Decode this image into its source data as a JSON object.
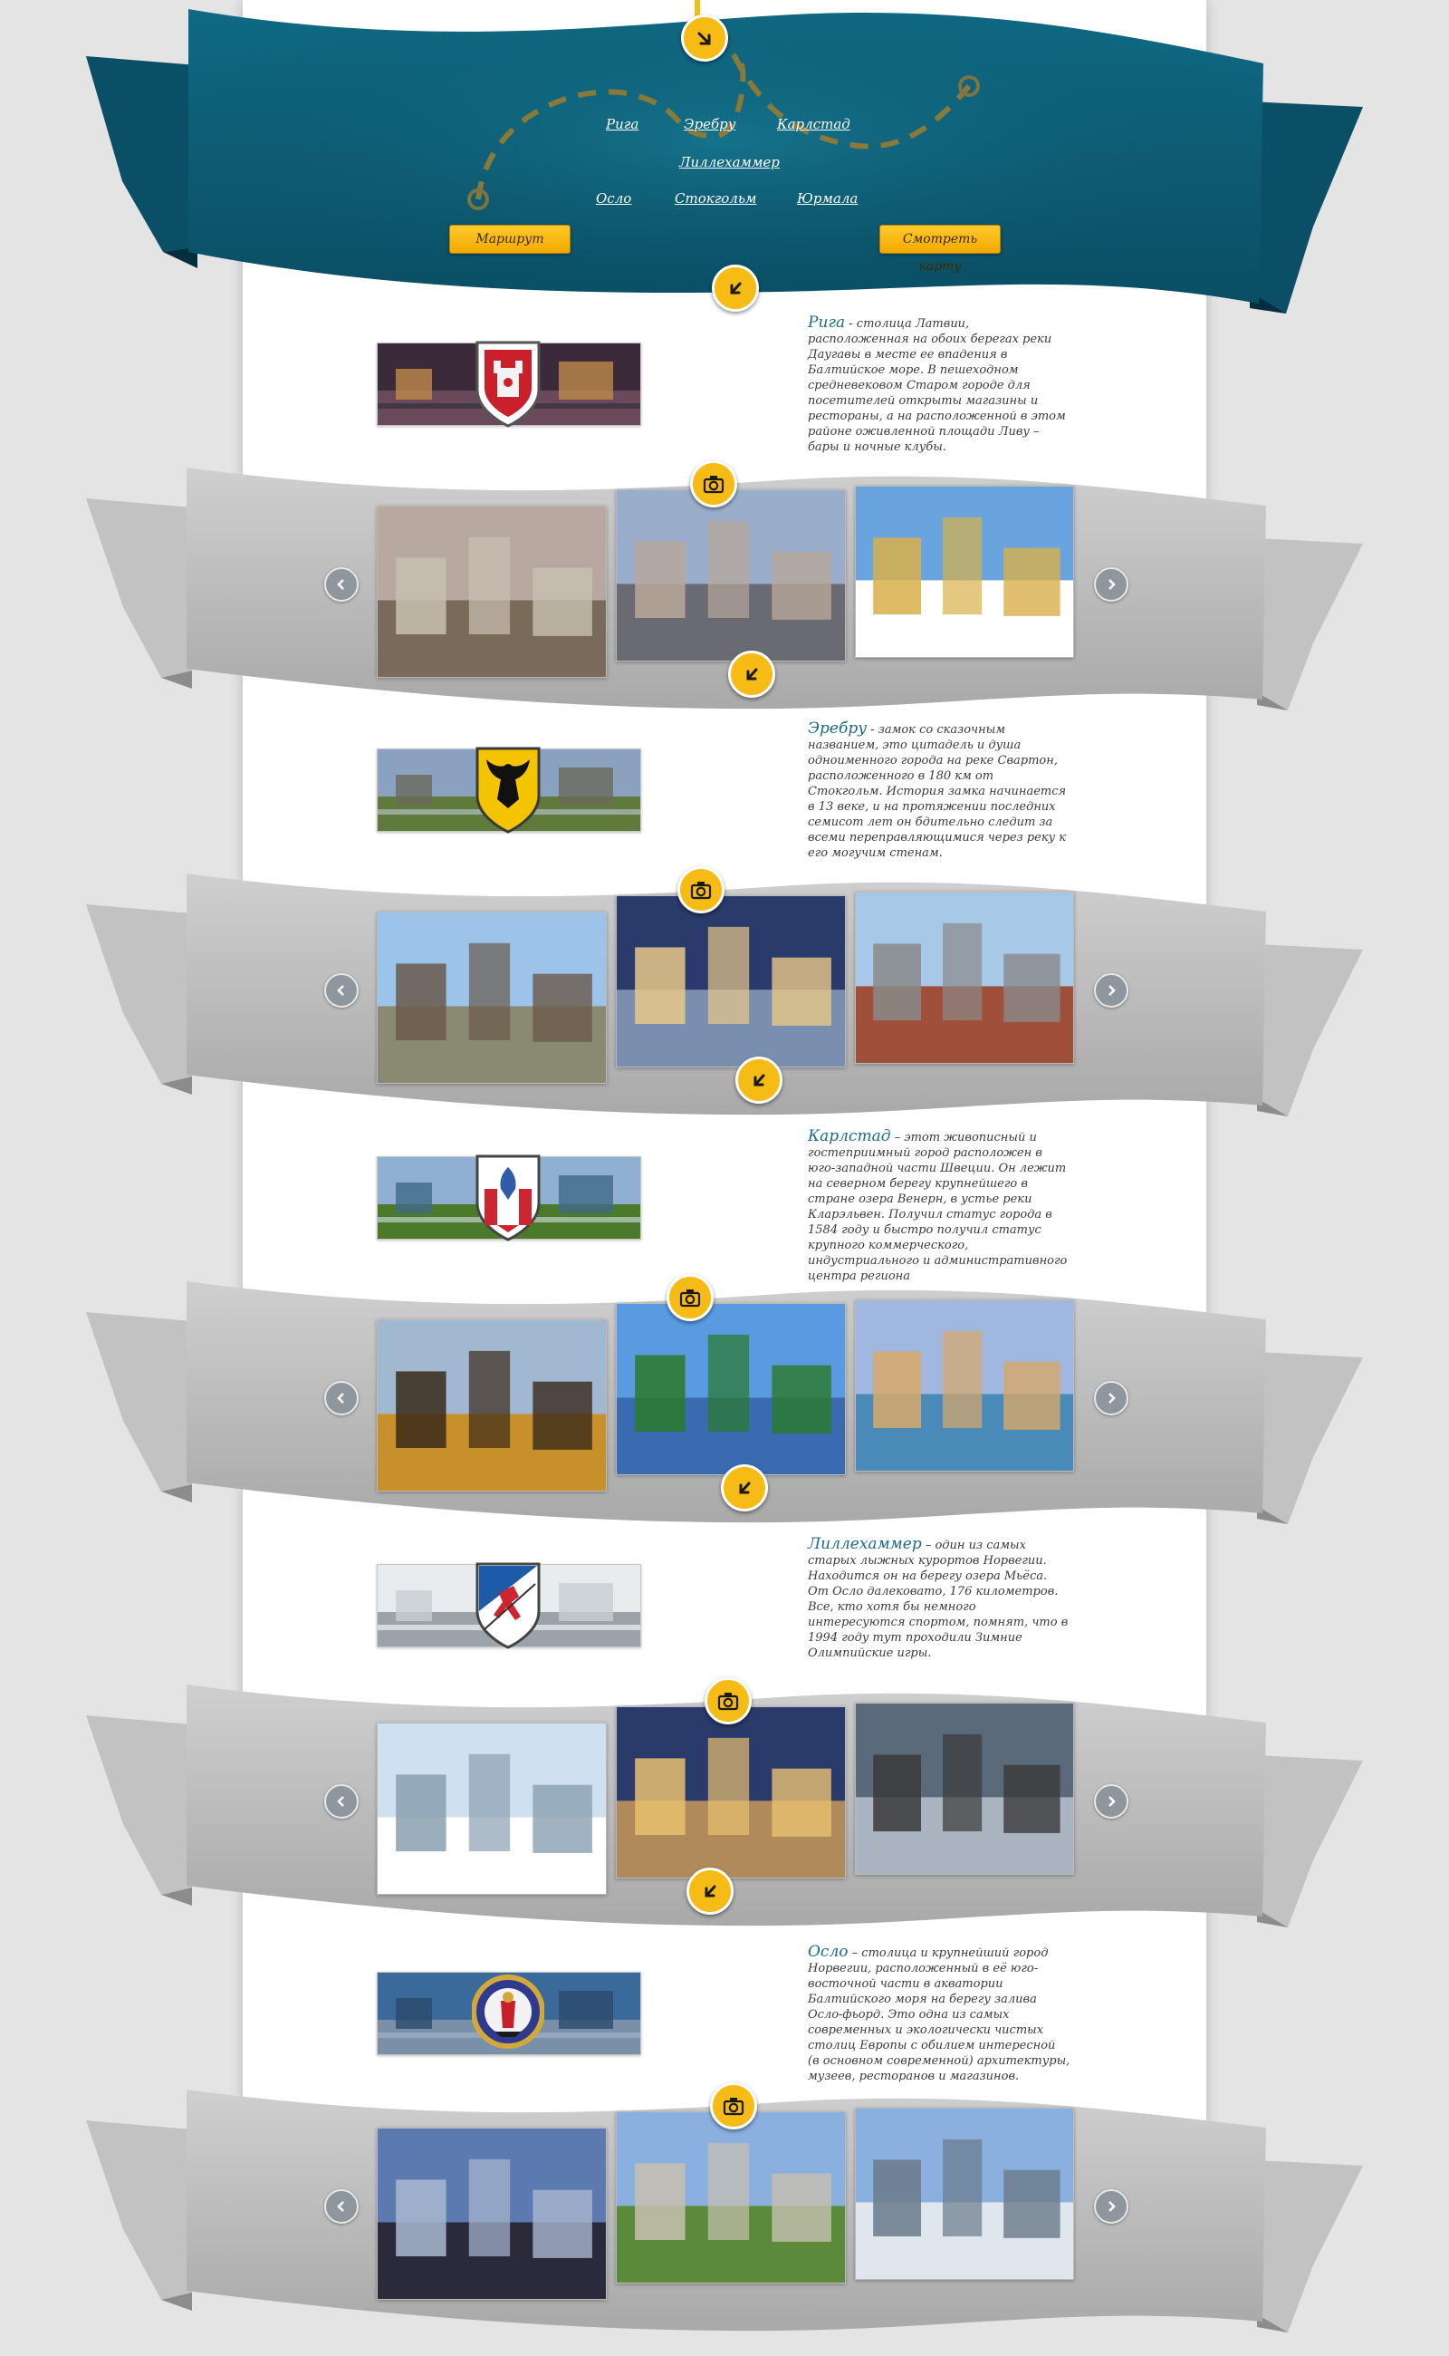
{
  "nav": {
    "links": [
      "Рига",
      "Эребру",
      "Карлстад",
      "Лиллехаммер",
      "Осло",
      "Стокгольм",
      "Юрмала"
    ],
    "route_button": "Маршрут",
    "map_button": "Смотреть карту"
  },
  "cities": [
    {
      "name": "Рига",
      "description": " - столица Латвии, расположенная на обоих берегах реки Даугавы в месте ее впадения в Балтийское море. В пешеходном средневековом Старом городе для посетителей открыты магазины и рестораны, а на расположенной в этом районе оживленной площади Ливу – бары и ночные клубы."
    },
    {
      "name": "Эребру",
      "description": " - замок со сказочным названием, это цитадель и душа одноименного города на реке Свартон, расположенного в 180 км от Стокгольм. История замка начинается в 13 веке, и на протяжении последних семисот лет он бдительно следит за всеми переправляющимися через реку к его могучим стенам."
    },
    {
      "name": "Карлстад",
      "description": " – этот живописный и гостеприимный город расположен в юго-западной части Швеции. Он лежит на северном берегу крупнейшего в стране озера Венерн, в устье реки Кларэльвен. Получил статус города в 1584 году и быстро получил статус крупного коммерческого, индустриального и административного центра региона"
    },
    {
      "name": "Лиллехаммер",
      "description": " – один из самых старых лыжных курортов Норвегии. Находится он на берегу озера Мьёса. От Осло далековато, 176 километров. Все, кто хотя бы немного интересуются спортом, помнят, что в 1994 году тут проходили Зимние Олимпийские игры."
    },
    {
      "name": "Осло",
      "description": " – столица и крупнейший город Норвегии, расположенный в её юго-восточной части в акватории Балтийского моря на берегу залива Осло-фьорд. Это одна из самых современных и экологически чистых столиц Европы с обилием интересной (в основном современной) архитектуры, музеев, ресторанов и магазинов."
    }
  ],
  "icons": {
    "next_badge": "arrow-down-badge-icon",
    "gallery_badge": "camera-icon",
    "prev": "chevron-left-icon",
    "next": "chevron-right-icon"
  },
  "colors": {
    "ribbon_teal": "#0b5a72",
    "ribbon_gray": "#bdbdbd",
    "badge_yellow": "#f6bb14",
    "button_yellow": "#ffc21a",
    "city_name": "#1a6a8b"
  }
}
